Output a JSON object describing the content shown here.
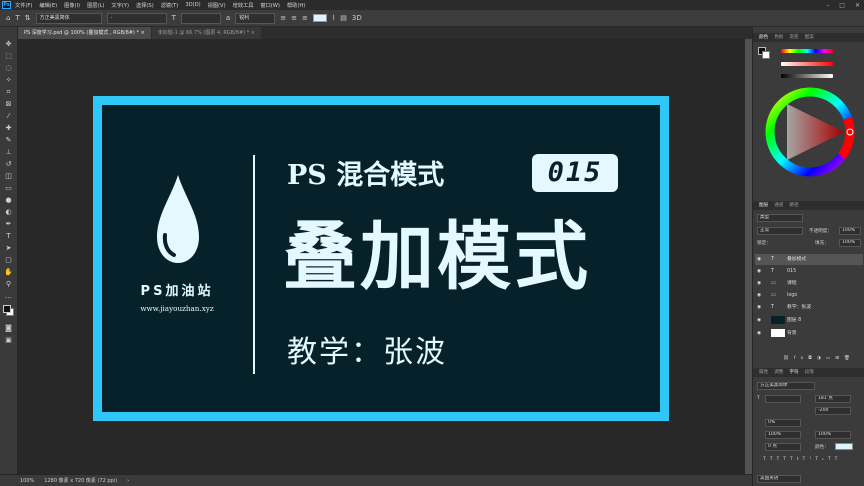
{
  "menu": {
    "app_logo": "Ps",
    "items": [
      "文件(F)",
      "编辑(E)",
      "图像(I)",
      "图层(L)",
      "文字(Y)",
      "选择(S)",
      "滤镜(T)",
      "3D(D)",
      "视图(V)",
      "增效工具",
      "窗口(W)",
      "帮助(H)"
    ]
  },
  "options": {
    "font_family": "方正美黑简体",
    "font_style": "-",
    "antialias": "锐利",
    "text_color": "#dff3ff"
  },
  "tabs": [
    {
      "label": "PS 深度学习.psd @ 100% (叠加模式 , RGB/8#) *"
    },
    {
      "label": "未标题-1 @ 66.7% (图层 4, RGB/8#) *"
    }
  ],
  "artwork": {
    "brand": "PS加油站",
    "url": "www.jiayouzhan.xyz",
    "title_main": "PS 混合模式",
    "episode": "015",
    "title_big": "叠加模式",
    "teacher": "教学：张波",
    "frame_color": "#2ec7f6",
    "bg_color": "#07212a"
  },
  "status": {
    "zoom": "100%",
    "doc_size": "1280 像素 x 720 像素 (72 ppi)"
  },
  "panels": {
    "color_tabs": [
      "颜色",
      "色板",
      "渐变",
      "图案"
    ],
    "layers_tabs": [
      "图层",
      "通道",
      "路径"
    ],
    "filter_kind": "类型",
    "blend_mode": "正常",
    "opacity_label": "不透明度：",
    "opacity": "100%",
    "lock_label": "锁定：",
    "fill_label": "填充：",
    "fill": "100%",
    "layers": [
      {
        "name": "叠加模式",
        "icon": "T",
        "selected": true
      },
      {
        "name": "015",
        "icon": "T",
        "selected": false
      },
      {
        "name": "课程",
        "icon": "folder",
        "selected": false
      },
      {
        "name": "logo",
        "icon": "folder",
        "selected": false
      },
      {
        "name": "教学：张波",
        "icon": "T",
        "selected": false
      },
      {
        "name": "图层 8",
        "icon": "image",
        "selected": false
      },
      {
        "name": "背景",
        "icon": "image",
        "selected": false
      }
    ],
    "char_tabs": [
      "属性",
      "调整",
      "字符",
      "段落"
    ],
    "char_font": "方正美黑简体",
    "char_size": "181 点",
    "char_tracking": "-200",
    "char_leading_scale": "0%",
    "char_vscale": "100%",
    "char_hscale": "100%",
    "char_baseline": "0 点",
    "char_color_label": "颜色：",
    "char_lang": "美国英语"
  }
}
